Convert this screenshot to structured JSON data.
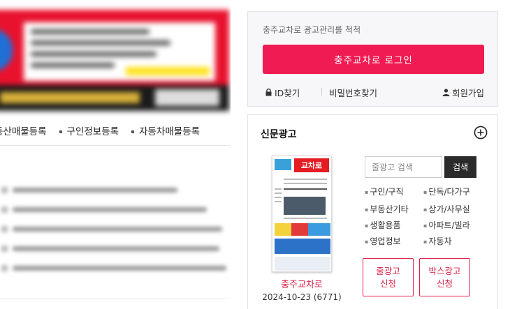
{
  "left": {
    "nav": [
      "동산매물등록",
      "구인정보등록",
      "자동차매물등록"
    ]
  },
  "login": {
    "hint": "충주교차로 광고관리를 척척",
    "login_label": "충주교차로 로그인",
    "find_id": "ID찾기",
    "find_password": "비밀번호찾기",
    "signup": "회원가입"
  },
  "ads": {
    "title": "신문광고",
    "paper_logo": "교차로",
    "paper_name": "충주교차로",
    "paper_date": "2024-10-23 (6771)",
    "search_placeholder": "줄광고 검색",
    "search_label": "검색",
    "categories": [
      "구인/구직",
      "단독/다가구",
      "부동산기타",
      "상가/사무실",
      "생활용품",
      "아파트/빌라",
      "영업정보",
      "자동차"
    ],
    "apply_line": [
      "줄광고",
      "신청"
    ],
    "apply_box": [
      "박스광고",
      "신청"
    ]
  },
  "colors": {
    "accent": "#ef1b52",
    "accent_text": "#d8224a",
    "dark_button": "#2b2b2b"
  }
}
